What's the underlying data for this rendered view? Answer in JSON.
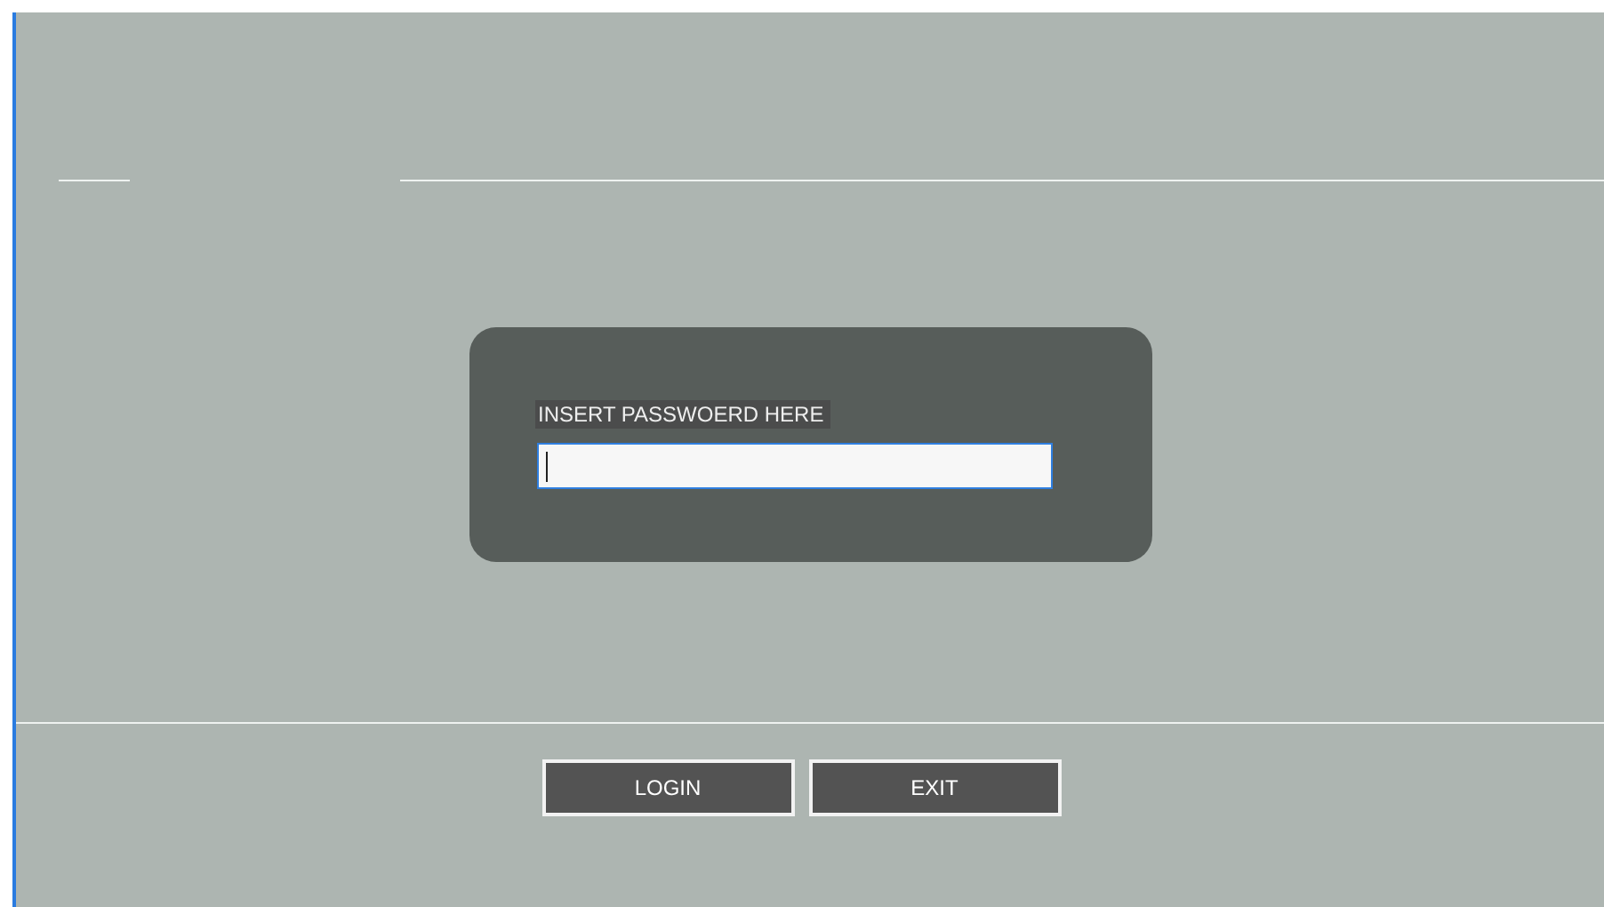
{
  "login_panel": {
    "label": "INSERT PASSWOERD HERE",
    "password_field": {
      "focused": true
    }
  },
  "buttons": [
    {
      "label": "LOGIN"
    },
    {
      "label": "EXIT"
    }
  ]
}
